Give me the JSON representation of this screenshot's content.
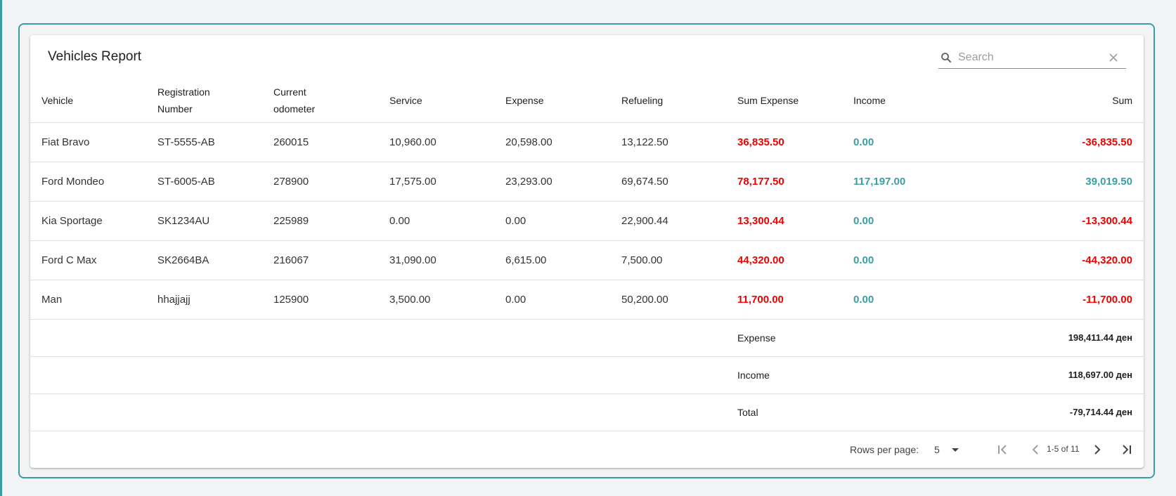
{
  "report": {
    "title": "Vehicles Report"
  },
  "search": {
    "placeholder": "Search",
    "value": ""
  },
  "table": {
    "headers": {
      "vehicle": "Vehicle",
      "registration_1": "Registration",
      "registration_2": "Number",
      "odometer_1": "Current",
      "odometer_2": "odometer",
      "service": "Service",
      "expense": "Expense",
      "refueling": "Refueling",
      "sum_expense": "Sum Expense",
      "income": "Income",
      "sum": "Sum"
    },
    "rows": [
      {
        "vehicle": "Fiat Bravo",
        "registration": "ST-5555-AB",
        "odometer": "260015",
        "service": "10,960.00",
        "expense": "20,598.00",
        "refueling": "13,122.50",
        "sum_expense": "36,835.50",
        "income": "0.00",
        "sum": "-36,835.50"
      },
      {
        "vehicle": "Ford Mondeo",
        "registration": "ST-6005-AB",
        "odometer": "278900",
        "service": "17,575.00",
        "expense": "23,293.00",
        "refueling": "69,674.50",
        "sum_expense": "78,177.50",
        "income": "117,197.00",
        "sum": "39,019.50"
      },
      {
        "vehicle": "Kia Sportage",
        "registration": "SK1234AU",
        "odometer": "225989",
        "service": "0.00",
        "expense": "0.00",
        "refueling": "22,900.44",
        "sum_expense": "13,300.44",
        "income": "0.00",
        "sum": "-13,300.44"
      },
      {
        "vehicle": "Ford C Max",
        "registration": "SK2664BA",
        "odometer": "216067",
        "service": "31,090.00",
        "expense": "6,615.00",
        "refueling": "7,500.00",
        "sum_expense": "44,320.00",
        "income": "0.00",
        "sum": "-44,320.00"
      },
      {
        "vehicle": "Man",
        "registration": "hhajjajj",
        "odometer": "125900",
        "service": "3,500.00",
        "expense": "0.00",
        "refueling": "50,200.00",
        "sum_expense": "11,700.00",
        "income": "0.00",
        "sum": "-11,700.00"
      }
    ],
    "summary": [
      {
        "label": "Expense",
        "value": "198,411.44 ден"
      },
      {
        "label": "Income",
        "value": "118,697.00 ден"
      },
      {
        "label": "Total",
        "value": "-79,714.44 ден"
      }
    ]
  },
  "pagination": {
    "rows_per_page_label": "Rows per page:",
    "rows_per_page": "5",
    "range": "1-5 of 11"
  },
  "colors": {
    "accent": "#3a9fa5",
    "negative": "#f00000",
    "positive": "#3a9fa5"
  }
}
